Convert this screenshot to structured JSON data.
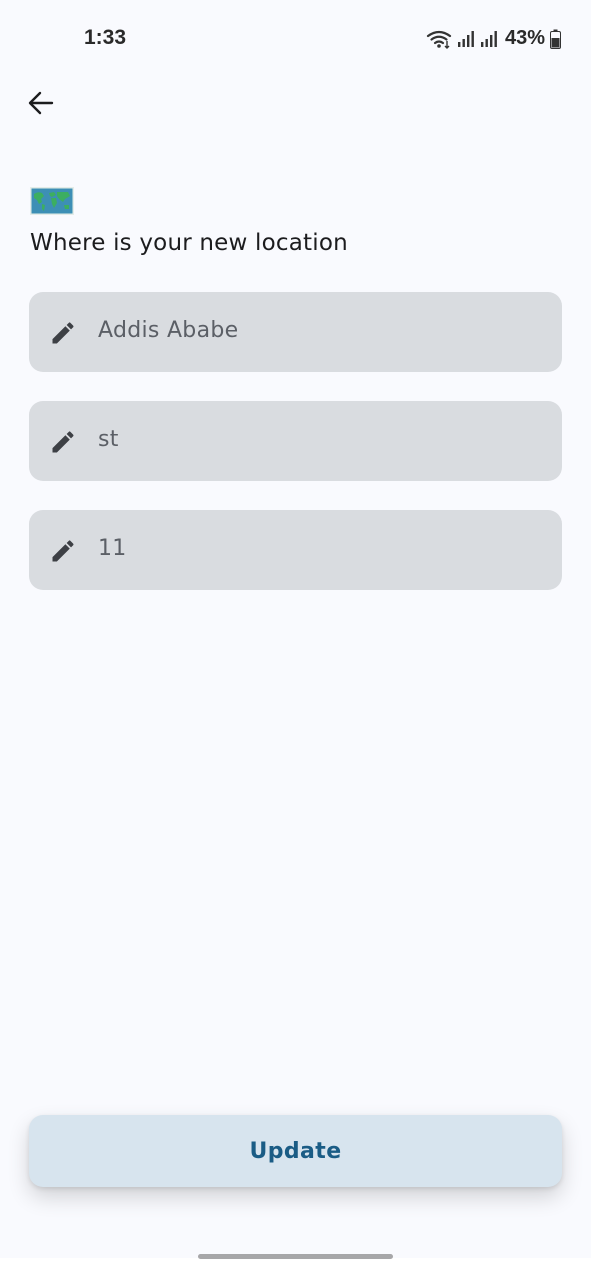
{
  "status_bar": {
    "time": "1:33",
    "battery": "43%",
    "icons": [
      "wifi-icon",
      "signal-icon",
      "signal-icon",
      "battery-icon"
    ]
  },
  "header": {
    "back_icon": "arrow-left-icon"
  },
  "content": {
    "map_icon": "world-map-icon",
    "prompt": "Where is your new location",
    "fields": [
      {
        "icon": "pencil-icon",
        "value": "Addis Ababe"
      },
      {
        "icon": "pencil-icon",
        "value": "st"
      },
      {
        "icon": "pencil-icon",
        "value": "11"
      }
    ]
  },
  "actions": {
    "update_label": "Update"
  },
  "colors": {
    "background": "#f9fafe",
    "field_bg": "#d9dce0",
    "button_bg": "#d7e4ee",
    "button_text": "#1a5c85"
  }
}
